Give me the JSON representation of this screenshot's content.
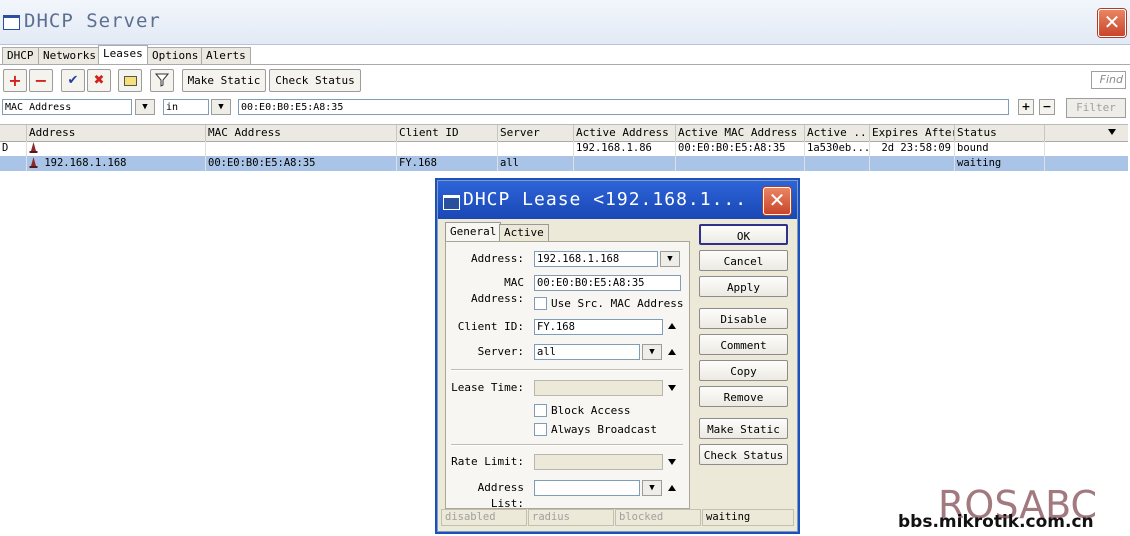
{
  "window": {
    "title": "DHCP Server"
  },
  "tabs": [
    {
      "label": "DHCP"
    },
    {
      "label": "Networks"
    },
    {
      "label": "Leases"
    },
    {
      "label": "Options"
    },
    {
      "label": "Alerts"
    }
  ],
  "toolbar": {
    "make_static": "Make Static",
    "check_status": "Check Status",
    "find_placeholder": "Find"
  },
  "filter": {
    "field": "MAC Address",
    "operator": "in",
    "value": "00:E0:B0:E5:A8:35",
    "filter_button": "Filter"
  },
  "table": {
    "columns": [
      "Address",
      "MAC Address",
      "Client ID",
      "Server",
      "Active Address",
      "Active MAC Address",
      "Active ...",
      "Expires After",
      "Status"
    ],
    "rows": [
      {
        "flag": "D",
        "address": "",
        "mac": "",
        "client_id": "",
        "server": "",
        "active_address": "192.168.1.86",
        "active_mac": "00:E0:B0:E5:A8:35",
        "active_host": "1a530eb...",
        "expires": "2d 23:58:09",
        "status": "bound"
      },
      {
        "flag": "",
        "address": "192.168.1.168",
        "mac": "00:E0:B0:E5:A8:35",
        "client_id": "FY.168",
        "server": "all",
        "active_address": "",
        "active_mac": "",
        "active_host": "",
        "expires": "",
        "status": "waiting"
      }
    ]
  },
  "dialog": {
    "title": "DHCP Lease <192.168.1...",
    "tabs": [
      {
        "label": "General"
      },
      {
        "label": "Active"
      }
    ],
    "fields": {
      "address_label": "Address:",
      "address_value": "192.168.1.168",
      "mac_label": "MAC Address:",
      "mac_value": "00:E0:B0:E5:A8:35",
      "use_src_mac": "Use Src. MAC Address",
      "client_id_label": "Client ID:",
      "client_id_value": "FY.168",
      "server_label": "Server:",
      "server_value": "all",
      "lease_time_label": "Lease Time:",
      "block_access": "Block Access",
      "always_broadcast": "Always Broadcast",
      "rate_limit_label": "Rate Limit:",
      "address_list_label": "Address List:"
    },
    "buttons": {
      "ok": "OK",
      "cancel": "Cancel",
      "apply": "Apply",
      "disable": "Disable",
      "comment": "Comment",
      "copy": "Copy",
      "remove": "Remove",
      "make_static": "Make Static",
      "check_status": "Check Status"
    },
    "status_bar": [
      "disabled",
      "radius",
      "blocked",
      "waiting"
    ]
  },
  "watermark": {
    "logo": "ROSABC",
    "site": "bbs.mikrotik.com.cn"
  },
  "colors": {
    "title_blue": "#1a47b5",
    "selected_row": "#a9c4e7",
    "close_red": "#c9452a"
  }
}
